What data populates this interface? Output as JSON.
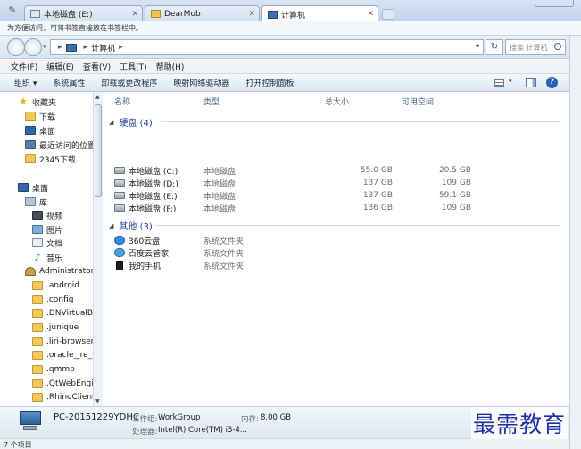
{
  "browser": {
    "tabs": [
      {
        "label": "本地磁盘 (E:)",
        "close": "✕",
        "icon": "drive-icon"
      },
      {
        "label": "DearMob",
        "close": "✕",
        "icon": "folder-icon"
      },
      {
        "label": "计算机",
        "close": "✕",
        "icon": "computer-icon"
      }
    ],
    "bookmark_hint": "为方便访问，可将书签直接放在书签栏中。"
  },
  "address": {
    "segment": "计算机",
    "separator": "▸",
    "search_placeholder": "搜索 计算机"
  },
  "menu": [
    "文件(F)",
    "编辑(E)",
    "查看(V)",
    "工具(T)",
    "帮助(H)"
  ],
  "commands": [
    "组织 ▾",
    "系统属性",
    "卸载或更改程序",
    "映射网络驱动器",
    "打开控制面板"
  ],
  "nav": {
    "favorites": "收藏夹",
    "fav_items": [
      "下载",
      "桌面",
      "最近访问的位置",
      "2345下载"
    ],
    "desktop": "桌面",
    "library": "库",
    "library_items": [
      "视频",
      "图片",
      "文档",
      "音乐"
    ],
    "user": "Administrator",
    "user_items": [
      ".android",
      ".config",
      ".DNVirtualBox",
      ".junique",
      ".liri-browser",
      ".oracle_jre_usa",
      ".qmmp",
      ".QtWebEngine",
      ".RhinoClient"
    ]
  },
  "columns": {
    "name": "名称",
    "type": "类型",
    "total": "总大小",
    "free": "可用空间"
  },
  "groups": {
    "drives": {
      "title": "硬盘 (4)"
    },
    "others": {
      "title": "其他 (3)"
    }
  },
  "drives": [
    {
      "name": "本地磁盘 (C:)",
      "type": "本地磁盘",
      "total": "55.0 GB",
      "free": "20.5 GB"
    },
    {
      "name": "本地磁盘 (D:)",
      "type": "本地磁盘",
      "total": "137 GB",
      "free": "109 GB"
    },
    {
      "name": "本地磁盘 (E:)",
      "type": "本地磁盘",
      "total": "137 GB",
      "free": "59.1 GB"
    },
    {
      "name": "本地磁盘 (F:)",
      "type": "本地磁盘",
      "total": "136 GB",
      "free": "109 GB"
    }
  ],
  "others": [
    {
      "name": "360云盘",
      "type": "系统文件夹"
    },
    {
      "name": "百度云管家",
      "type": "系统文件夹"
    },
    {
      "name": "我的手机",
      "type": "系统文件夹"
    }
  ],
  "details": {
    "pc_name": "PC-20151229YDHC",
    "workgroup_label": "工作组:",
    "workgroup": "WorkGroup",
    "memory_label": "内存:",
    "memory": "8.00 GB",
    "cpu_label": "处理器:",
    "cpu": "Intel(R) Core(TM) i3-4..."
  },
  "status": "7 个项目",
  "watermark": "最需教育"
}
